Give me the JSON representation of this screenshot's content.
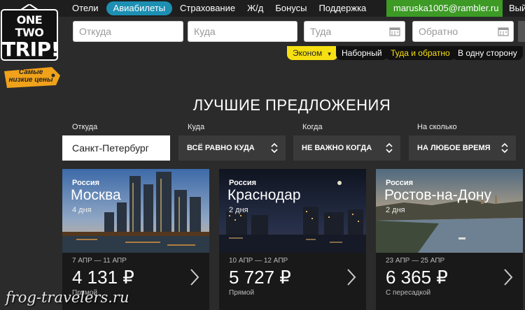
{
  "nav": {
    "items": [
      {
        "label": "Отели"
      },
      {
        "label": "Авиабилеты"
      },
      {
        "label": "Страхование"
      },
      {
        "label": "Ж/д"
      },
      {
        "label": "Бонусы"
      },
      {
        "label": "Поддержка"
      }
    ],
    "user_email": "maruska1005@rambler.ru",
    "exit_label": "Выйти"
  },
  "logo": {
    "line1": "ONE TWO",
    "line2": "TRIP!",
    "tag": "Самые низкие цены"
  },
  "search": {
    "from_placeholder": "Откуда",
    "to_placeholder": "Куда",
    "depart_placeholder": "Туда",
    "return_placeholder": "Обратно"
  },
  "filters": {
    "class_label": "Эконом",
    "multi_label": "Наборный",
    "roundtrip_label": "Туда и обратно",
    "oneway_label": "В одну сторону"
  },
  "offers": {
    "heading": "ЛУЧШИЕ ПРЕДЛОЖЕНИЯ",
    "from_label": "Откуда",
    "from_value": "Санкт-Петербург",
    "to_label": "Куда",
    "to_value": "ВСЁ РАВНО КУДА",
    "when_label": "Когда",
    "when_value": "НЕ ВАЖНО КОГДА",
    "duration_label": "На сколько",
    "duration_value": "НА ЛЮБОЕ ВРЕМЯ",
    "cards": [
      {
        "country": "Россия",
        "city": "Москва",
        "days": "4 дня",
        "dates": "7 АПР — 11 АПР",
        "price": "4 131 ₽",
        "note": "Прямой"
      },
      {
        "country": "Россия",
        "city": "Краснодар",
        "days": "2 дня",
        "dates": "10 АПР — 12 АПР",
        "price": "5 727 ₽",
        "note": "Прямой"
      },
      {
        "country": "Россия",
        "city": "Ростов-на-Дону",
        "days": "2 дня",
        "dates": "23 АПР — 25 АПР",
        "price": "6 365 ₽",
        "note": "С пересадкой"
      }
    ]
  },
  "watermark": "frog-travelers.ru",
  "colors": {
    "accent_blue": "#1d8fb3",
    "user_green": "#3c9a25",
    "yellow": "#f7e012",
    "background": "#2b2b2b"
  }
}
